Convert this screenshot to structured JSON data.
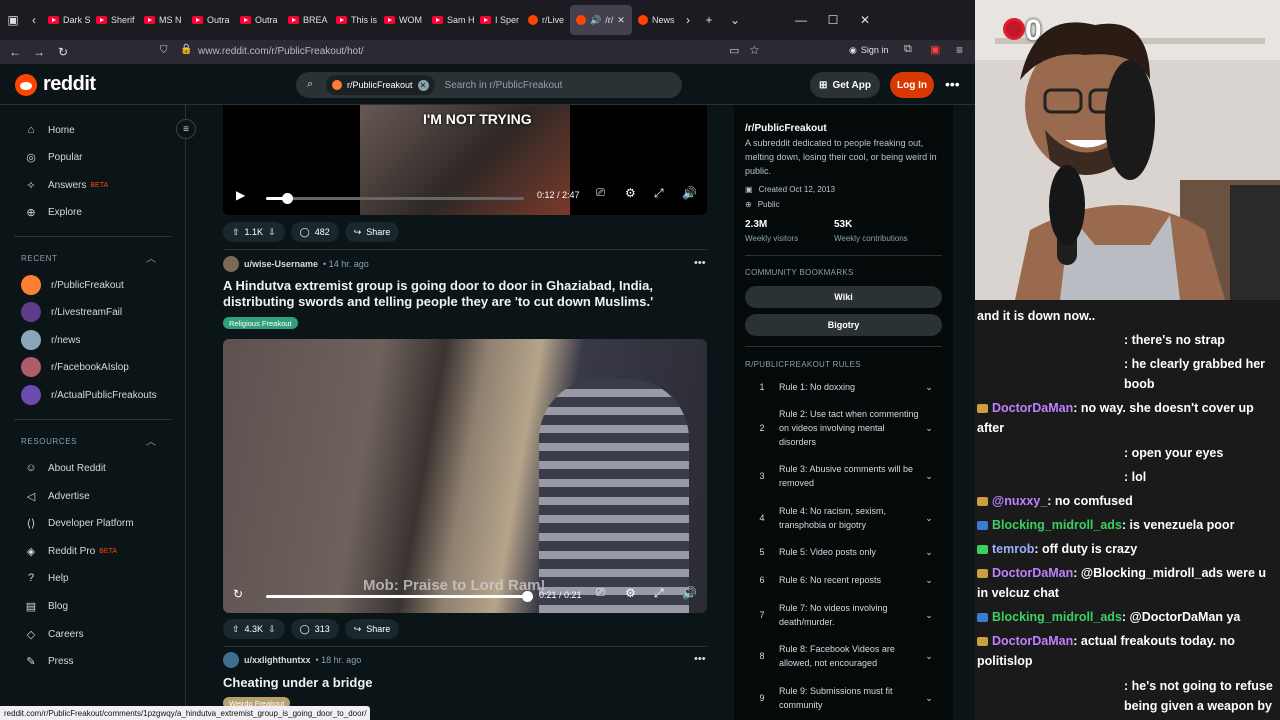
{
  "browser": {
    "tabs": [
      "Dark S",
      "Sherif",
      "MS N",
      "Outra",
      "Outra",
      "BREA",
      "This is",
      "WOM",
      "Sam H",
      "I Sper",
      "r/Live",
      "/r/",
      "News"
    ],
    "url": "www.reddit.com/r/PublicFreakout/hot/",
    "sign_in": "Sign in",
    "status_url": "reddit.com/r/PublicFreakout/comments/1pzgwqy/a_hindutva_extremist_group_is_going_door_to_door/"
  },
  "header": {
    "logo": "reddit",
    "search_chip": "r/PublicFreakout",
    "search_placeholder": "Search in r/PublicFreakout",
    "get_app": "Get App",
    "login": "Log In"
  },
  "leftnav": {
    "main": [
      {
        "label": "Home",
        "icon": "home-icon"
      },
      {
        "label": "Popular",
        "icon": "popular-icon"
      },
      {
        "label": "Answers",
        "icon": "answers-icon",
        "badge": "BETA"
      },
      {
        "label": "Explore",
        "icon": "explore-icon"
      }
    ],
    "recent_title": "RECENT",
    "recent": [
      {
        "label": "r/PublicFreakout",
        "color": "#ff7f32"
      },
      {
        "label": "r/LivestreamFail",
        "color": "#5e3d8a"
      },
      {
        "label": "r/news",
        "color": "#8aa6b8"
      },
      {
        "label": "r/FacebookAIslop",
        "color": "#b05a6a"
      },
      {
        "label": "r/ActualPublicFreakouts",
        "color": "#6d4ab0"
      }
    ],
    "resources_title": "RESOURCES",
    "resources": [
      {
        "label": "About Reddit"
      },
      {
        "label": "Advertise"
      },
      {
        "label": "Developer Platform"
      },
      {
        "label": "Reddit Pro",
        "badge": "BETA"
      },
      {
        "label": "Help"
      },
      {
        "label": "Blog"
      },
      {
        "label": "Careers"
      },
      {
        "label": "Press"
      }
    ]
  },
  "feed": {
    "video1": {
      "caption": "I'M NOT TRYING",
      "time": "0:12 / 2:47",
      "progress": 0.08
    },
    "post1_actions": {
      "votes": "1.1K",
      "comments": "482",
      "share": "Share"
    },
    "post2": {
      "user": "u/wise-Username",
      "time": "• 14 hr. ago",
      "title": "A Hindutva extremist group is going door to door in Ghaziabad, India, distributing swords and telling people they are 'to cut down Muslims.'",
      "flair": "Religious Freakout",
      "video_subtitle": "Mob: Praise to Lord Ram!",
      "video_time": "0:21 / 0:21",
      "progress": 1.0,
      "votes": "4.3K",
      "comments": "313",
      "share": "Share"
    },
    "post3": {
      "user": "u/xxlighthuntxx",
      "time": "• 18 hr. ago",
      "title": "Cheating under a bridge",
      "flair": "Weirdo Freakout"
    }
  },
  "sidebar": {
    "title": "/r/PublicFreakout",
    "description": "A subreddit dedicated to people freaking out, melting down, losing their cool, or being weird in public.",
    "created": "Created Oct 12, 2013",
    "visibility": "Public",
    "stats": [
      {
        "value": "2.3M",
        "label": "Weekly visitors"
      },
      {
        "value": "53K",
        "label": "Weekly contributions"
      }
    ],
    "bookmarks_title": "COMMUNITY BOOKMARKS",
    "bookmarks": [
      "Wiki",
      "Bigotry"
    ],
    "rules_title": "R/PUBLICFREAKOUT RULES",
    "rules": [
      {
        "n": "1",
        "text": "Rule 1: No doxxing"
      },
      {
        "n": "2",
        "text": "Rule 2: Use tact when commenting on videos involving mental disorders"
      },
      {
        "n": "3",
        "text": "Rule 3: Abusive comments will be removed"
      },
      {
        "n": "4",
        "text": "Rule 4: No racism, sexism, transphobia or bigotry"
      },
      {
        "n": "5",
        "text": "Rule 5: Video posts only"
      },
      {
        "n": "6",
        "text": "Rule 6: No recent reposts"
      },
      {
        "n": "7",
        "text": "Rule 7: No videos involving death/murder."
      },
      {
        "n": "8",
        "text": "Rule 8: Facebook Videos are allowed, not encouraged"
      },
      {
        "n": "9",
        "text": "Rule 9: Submissions must fit community"
      }
    ]
  },
  "stream": {
    "overlay_count": "0",
    "chat": [
      {
        "name": "",
        "text": "and it is down now..",
        "color": "#ffffff"
      },
      {
        "name": "",
        "text": ": there's no strap",
        "color": "#ffffff"
      },
      {
        "name": "",
        "text": ": he clearly grabbed her boob",
        "color": "#ffffff"
      },
      {
        "name": "DoctorDaMan",
        "text": ": no way. she doesn't cover up after",
        "color": "#c080ff"
      },
      {
        "name": "",
        "text": ": open your eyes",
        "color": "#ffffff"
      },
      {
        "name": "",
        "text": ": lol",
        "color": "#ffffff"
      },
      {
        "name": "@nuxxy_",
        "text": ": no comfused",
        "color": "#c080ff"
      },
      {
        "name": "Blocking_midroll_ads",
        "text": ": is venezuela poor",
        "color": "#3ccf64"
      },
      {
        "name": "temrob",
        "text": ": off duty is crazy",
        "color": "#9ab0ff"
      },
      {
        "name": "DoctorDaMan",
        "text": ": @Blocking_midroll_ads were u in velcuz chat",
        "color": "#c080ff"
      },
      {
        "name": "Blocking_midroll_ads",
        "text": ": @DoctorDaMan ya",
        "color": "#3ccf64"
      },
      {
        "name": "DoctorDaMan",
        "text": ": actual freakouts today. no politislop",
        "color": "#c080ff"
      },
      {
        "name": "",
        "text": ": he's not going to refuse being given a weapon by an angry mob",
        "color": "#ffffff"
      }
    ]
  }
}
